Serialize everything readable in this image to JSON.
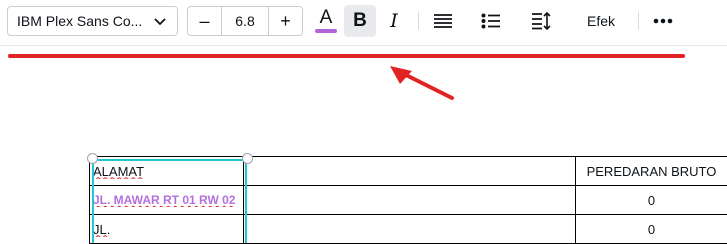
{
  "toolbar": {
    "font_family": "IBM Plex Sans Co...",
    "font_size": "6.8",
    "decrease_label": "–",
    "increase_label": "+",
    "text_color_letter": "A",
    "bold_label": "B",
    "italic_label": "I",
    "effects_label": "Efek",
    "text_color_swatch": "#b066d9"
  },
  "table": {
    "rows": [
      {
        "col1": "ALAMAT",
        "col3": "PEREDARAN BRUTO"
      },
      {
        "col1": "JL. MAWAR RT 01 RW 02",
        "col3": "0"
      },
      {
        "col1": "JL.",
        "col3": "0"
      }
    ]
  },
  "colors": {
    "annotation_red": "#e02424",
    "selection_cyan": "#1fc7d6",
    "highlight_purple": "#b570e0"
  }
}
